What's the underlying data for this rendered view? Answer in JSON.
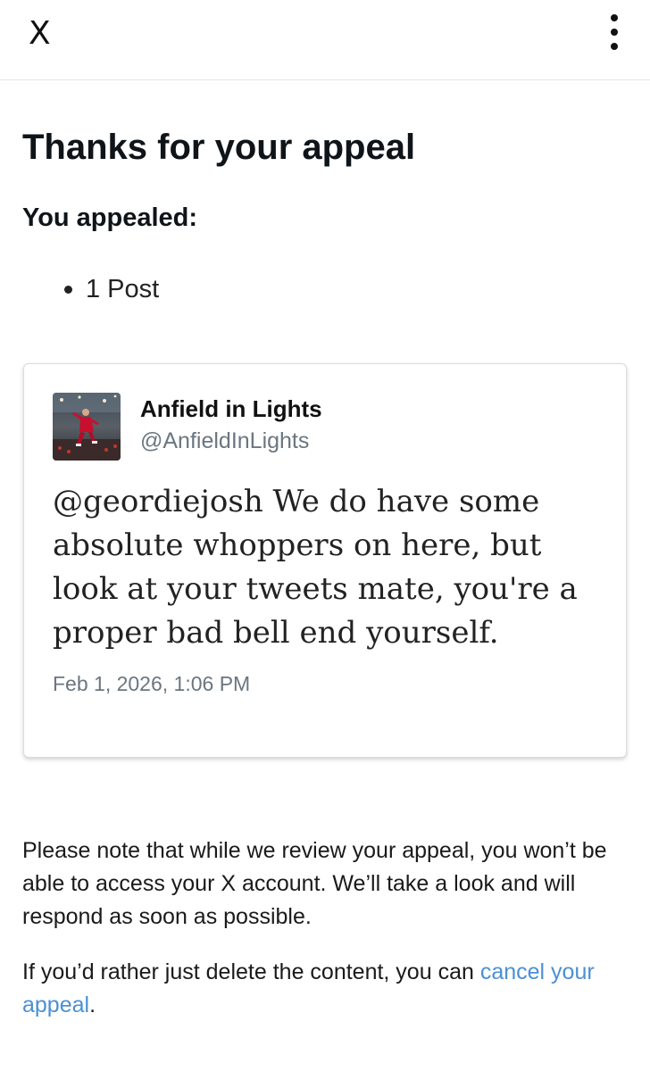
{
  "header": {
    "close_label": "X",
    "close_icon": "close-icon",
    "more_icon": "more-options-icon"
  },
  "main": {
    "title": "Thanks for your appeal",
    "subtitle": "You appealed:",
    "appealed_items": [
      "1 Post"
    ]
  },
  "post": {
    "author_name": "Anfield in Lights",
    "author_handle": "@AnfieldInLights",
    "text": "@geordiejosh We do have some absolute whoppers on here, but look at your tweets mate, you're a proper bad bell end yourself.",
    "timestamp": "Feb 1, 2026, 1:06 PM"
  },
  "notice": {
    "review_note": "Please note that while we review your appeal, you won’t be able to access your X account. We’ll take a look and will respond as soon as possible.",
    "cancel_prefix": "If you’d rather just delete the content, you can ",
    "cancel_link": "cancel your appeal",
    "cancel_suffix": "."
  },
  "colors": {
    "text": "#0f1419",
    "secondary_text": "#6b7680",
    "link": "#4a90d6",
    "divider": "#e6e6e6"
  }
}
